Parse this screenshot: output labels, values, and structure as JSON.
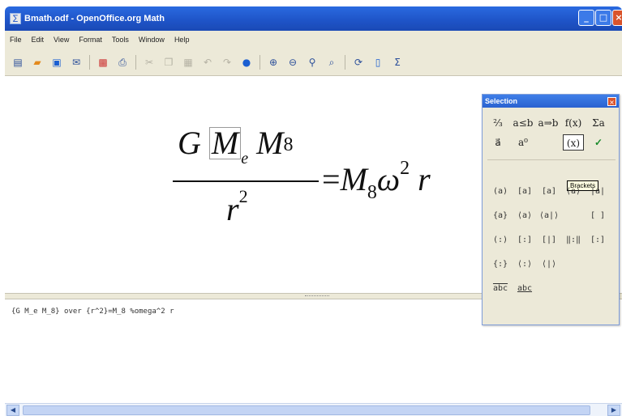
{
  "window": {
    "title": "Bmath.odf - OpenOffice.org Math",
    "app_icon": "math-doc-icon"
  },
  "menu": {
    "items": [
      "File",
      "Edit",
      "View",
      "Format",
      "Tools",
      "Window",
      "Help"
    ]
  },
  "toolbar": {
    "icons": [
      "new-doc-icon",
      "open-folder-icon",
      "save-icon",
      "email-icon",
      "export-pdf-icon",
      "print-icon",
      "cut-icon",
      "copy-icon",
      "paste-icon",
      "undo-icon",
      "redo-icon",
      "help-icon",
      "zoom-in-icon",
      "zoom-out-icon",
      "zoom-100-icon",
      "show-all-icon",
      "update-icon",
      "formula-cursor-icon",
      "symbols-icon"
    ]
  },
  "formula": {
    "num_G": "G",
    "num_M1": "M",
    "num_sub_e": "e",
    "num_M2": "M",
    "num_sub_8": "8",
    "den_r": "r",
    "den_sup_2": "2",
    "rhs_eq": "=",
    "rhs_M": "M",
    "rhs_sub_8": "8",
    "rhs_omega": "ω",
    "rhs_sup_2": "2",
    "rhs_r": "r"
  },
  "command": {
    "text": "{G M_e M_8} over {r^2}=M_8 %omega^2 r"
  },
  "selection_panel": {
    "title": "Selection",
    "categories_row1": [
      "⅔",
      "a≤b",
      "a⇒b",
      "f(x)",
      "Σa"
    ],
    "categories_row2": [
      "a⃗",
      "a⁰",
      "",
      "(x)",
      "✓"
    ],
    "tooltip": "Brackets",
    "operators": [
      [
        "(a)",
        "[a]",
        "[a]",
        "⟨a⟩",
        "|a|"
      ],
      [
        "{a}",
        "⟨a⟩",
        "⟨a|⟩",
        "",
        "[ ]"
      ],
      [
        "(:)",
        "[:]",
        "[|]",
        "‖:‖",
        "[:]"
      ],
      [
        "{:}",
        "⟨:⟩",
        "⟨|⟩",
        "",
        ""
      ],
      [
        "abc",
        "abc",
        "",
        "",
        ""
      ]
    ]
  }
}
